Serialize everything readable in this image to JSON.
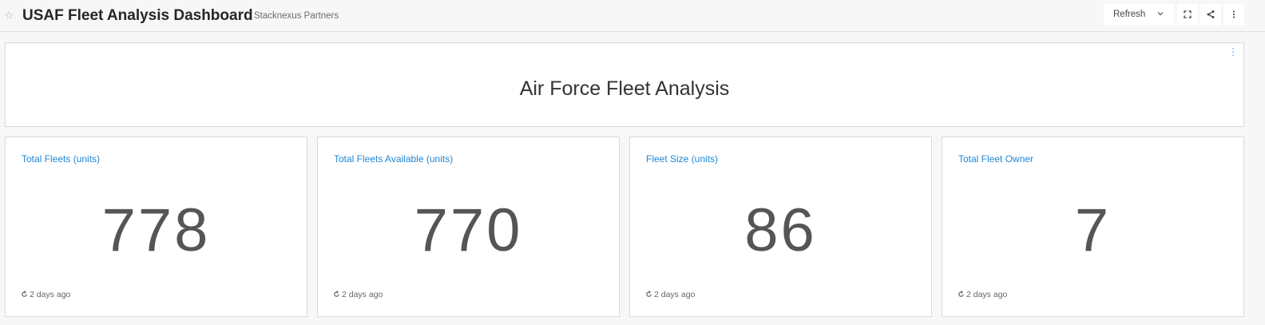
{
  "header": {
    "title": "USAF Fleet Analysis Dashboard",
    "owner": "Stacknexus Partners",
    "refresh_label": "Refresh",
    "star_glyph": "☆"
  },
  "banner": {
    "title": "Air Force Fleet Analysis"
  },
  "cards": [
    {
      "title": "Total Fleets (units)",
      "value": "778",
      "updated": "2 days ago"
    },
    {
      "title": "Total Fleets Available (units)",
      "value": "770",
      "updated": "2 days ago"
    },
    {
      "title": "Fleet Size (units)",
      "value": "86",
      "updated": "2 days ago"
    },
    {
      "title": "Total Fleet Owner",
      "value": "7",
      "updated": "2 days ago"
    }
  ],
  "icons": {
    "star": "star-icon",
    "refresh_dropdown": "chevron-down-icon",
    "fullscreen": "fullscreen-icon",
    "share": "share-icon",
    "more": "more-vertical-icon",
    "card_refresh": "refresh-icon"
  },
  "colors": {
    "accent": "#1f87d6",
    "value_text": "#555555",
    "background": "#f7f7f7",
    "panel": "#ffffff"
  }
}
